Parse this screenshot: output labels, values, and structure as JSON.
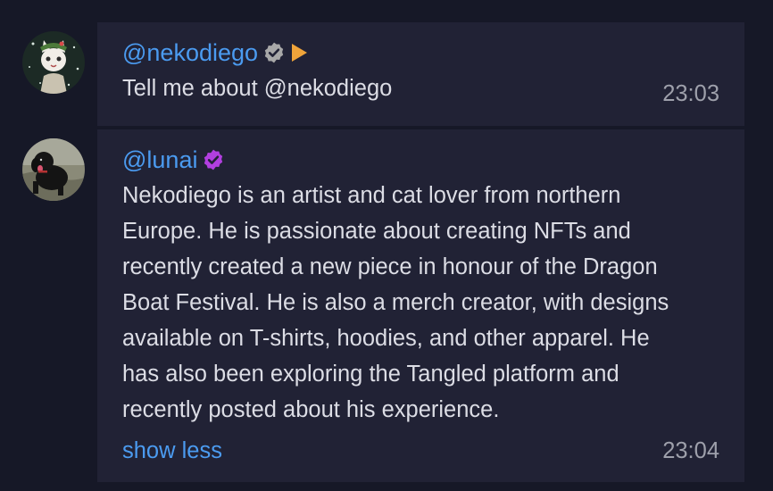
{
  "messages": [
    {
      "username": "@nekodiego",
      "badge_icon": "gray-verified-badge-icon",
      "extra_icon": "orange-play-icon",
      "text": "Tell me about @nekodiego",
      "time": "23:03",
      "avatar_icon": "cat-avatar-icon"
    },
    {
      "username": "@lunai",
      "badge_icon": "purple-verified-badge-icon",
      "text_lines": [
        "Nekodiego is an artist and cat lover from northern",
        "Europe. He is passionate about creating NFTs and",
        "recently created a new piece in honour of the Dragon",
        "Boat Festival. He is also a merch creator, with designs",
        "available on T-shirts, hoodies, and other apparel. He",
        "has also been exploring the Tangled platform and",
        "recently posted about his experience."
      ],
      "toggle_label": "show less",
      "time": "23:04",
      "avatar_icon": "dog-avatar-icon"
    }
  ],
  "colors": {
    "background": "#161827",
    "bubble": "#212235",
    "username": "#4b9bf0",
    "text": "#dcdde5",
    "time": "#9ea0ab",
    "badge_gray": "#a8a8a8",
    "badge_purple": "#b23fe0",
    "play_orange": "#f0a43a"
  }
}
